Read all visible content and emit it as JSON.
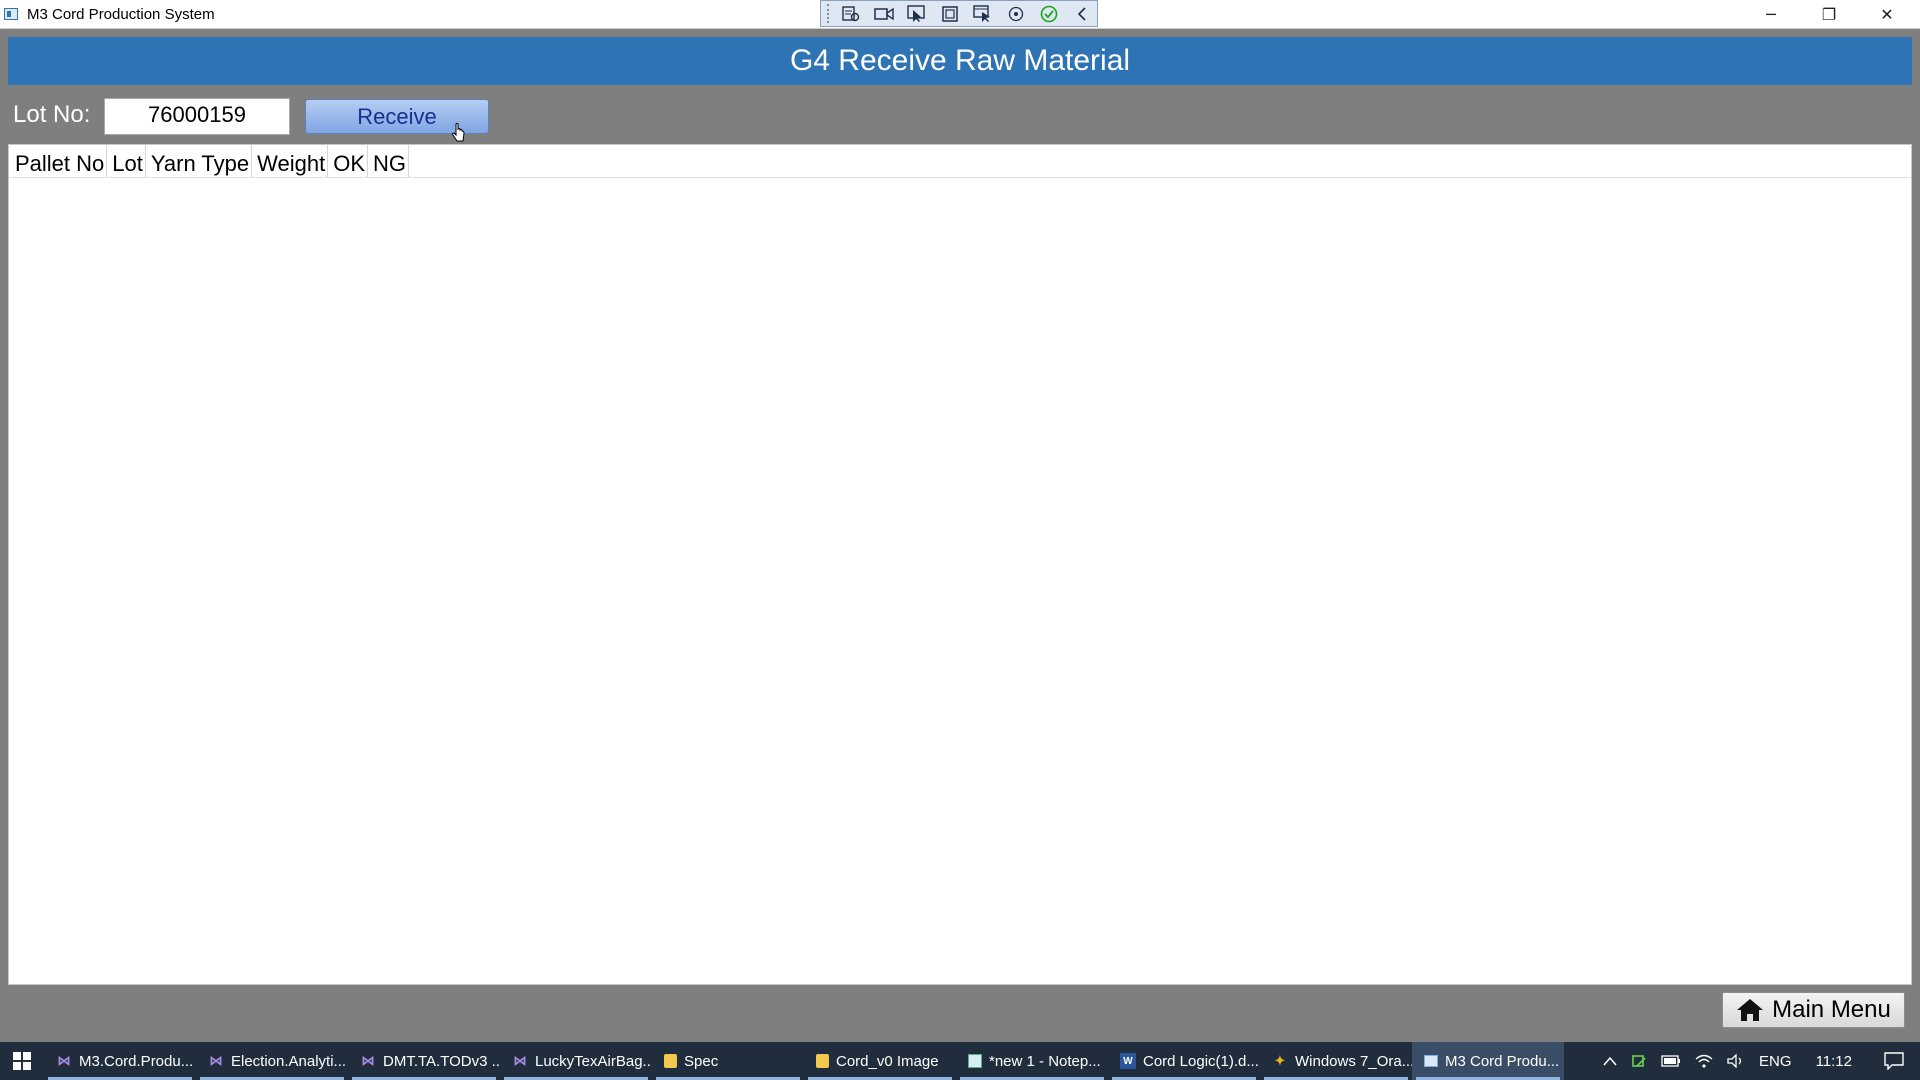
{
  "window": {
    "title": "M3 Cord Production System",
    "minimize_glyph": "─",
    "maximize_glyph": "❐",
    "close_glyph": "✕"
  },
  "capture_toolbar": {
    "icons": [
      "record-settings-icon",
      "video-icon",
      "select-region-icon",
      "fullscreen-icon",
      "select-window-icon",
      "audio-icon",
      "done-icon",
      "collapse-icon"
    ]
  },
  "header": {
    "title": "G4 Receive Raw Material",
    "background_color": "#2e74b5"
  },
  "lot": {
    "label": "Lot No:",
    "value": "76000159"
  },
  "receive_button": {
    "label": "Receive"
  },
  "grid": {
    "columns": [
      "Pallet No",
      "Lot",
      "Yarn Type",
      "Weight",
      "OK",
      "NG"
    ],
    "rows": []
  },
  "main_menu_button": {
    "label": "Main Menu",
    "icon": "home-icon"
  },
  "taskbar": {
    "items": [
      {
        "label": "M3.Cord.Produ...",
        "icon": "visual-studio-icon"
      },
      {
        "label": "Election.Analyti...",
        "icon": "visual-studio-icon"
      },
      {
        "label": "DMT.TA.TODv3 ...",
        "icon": "visual-studio-icon"
      },
      {
        "label": "LuckyTexAirBag...",
        "icon": "visual-studio-icon"
      },
      {
        "label": "Spec",
        "icon": "folder-icon"
      },
      {
        "label": "Cord_v0 Image",
        "icon": "folder-icon"
      },
      {
        "label": "*new 1 - Notep...",
        "icon": "notepad-icon"
      },
      {
        "label": "Cord Logic(1).d...",
        "icon": "word-icon"
      },
      {
        "label": "Windows 7_Ora...",
        "icon": "windows-icon"
      },
      {
        "label": "M3 Cord Produ...",
        "icon": "app-icon"
      }
    ],
    "tray": {
      "language": "ENG",
      "time": "11:12"
    }
  }
}
